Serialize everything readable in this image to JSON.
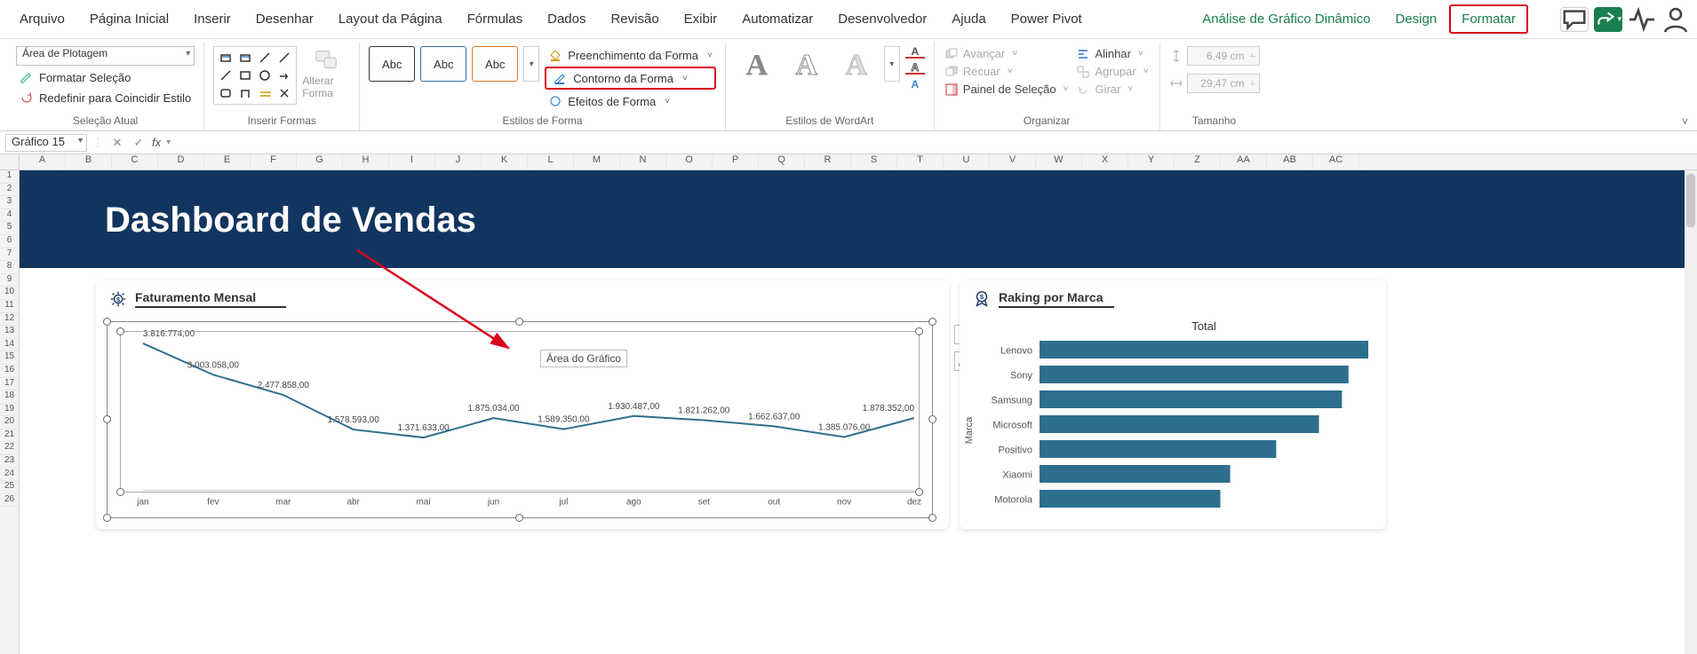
{
  "tabs": {
    "file": "Arquivo",
    "home": "Página Inicial",
    "insert": "Inserir",
    "draw": "Desenhar",
    "layout": "Layout da Página",
    "formulas": "Fórmulas",
    "data": "Dados",
    "review": "Revisão",
    "view": "Exibir",
    "automate": "Automatizar",
    "developer": "Desenvolvedor",
    "help": "Ajuda",
    "powerpivot": "Power Pivot",
    "ctx_analyze": "Análise de Gráfico Dinâmico",
    "ctx_design": "Design",
    "ctx_format": "Formatar"
  },
  "ribbon": {
    "current_selection": {
      "element": "Área de Plotagem",
      "format_selection": "Formatar Seleção",
      "reset": "Redefinir para Coincidir Estilo",
      "label": "Seleção Atual"
    },
    "insert_shapes": {
      "change": "Alterar Forma",
      "label": "Inserir Formas"
    },
    "shape_styles": {
      "abc": "Abc",
      "fill": "Preenchimento da Forma",
      "outline": "Contorno da Forma",
      "effects": "Efeitos de Forma",
      "label": "Estilos de Forma"
    },
    "wordart": {
      "label": "Estilos de WordArt"
    },
    "arrange": {
      "forward": "Avançar",
      "backward": "Recuar",
      "pane": "Painel de Seleção",
      "align": "Alinhar",
      "group": "Agrupar",
      "rotate": "Girar",
      "label": "Organizar"
    },
    "size": {
      "h": "6,49 cm",
      "w": "29,47 cm",
      "label": "Tamanho"
    }
  },
  "formula_bar": {
    "name": "Gráfico 15",
    "fx": "fx",
    "value": ""
  },
  "columns": [
    "A",
    "B",
    "C",
    "D",
    "E",
    "F",
    "G",
    "H",
    "I",
    "J",
    "K",
    "L",
    "M",
    "N",
    "O",
    "P",
    "Q",
    "R",
    "S",
    "T",
    "U",
    "V",
    "W",
    "X",
    "Y",
    "Z",
    "AA",
    "AB",
    "AC"
  ],
  "rows": [
    "1",
    "2",
    "3",
    "4",
    "5",
    "6",
    "7",
    "8",
    "9",
    "10",
    "11",
    "12",
    "13",
    "14",
    "15",
    "16",
    "17",
    "18",
    "19",
    "20",
    "21",
    "22",
    "23",
    "24",
    "25",
    "26"
  ],
  "dashboard": {
    "title": "Dashboard de Vendas",
    "chart1_title": "Faturamento Mensal",
    "chart2_title": "Raking por Marca",
    "chart2_inner": "Total",
    "chart2_ylabel": "Marca",
    "tooltip": "Área do Gráfico"
  },
  "chart_data": [
    {
      "type": "line",
      "title": "Faturamento Mensal",
      "categories": [
        "jan",
        "fev",
        "mar",
        "abr",
        "mai",
        "jun",
        "jul",
        "ago",
        "set",
        "out",
        "nov",
        "dez"
      ],
      "values": [
        3816774.0,
        3003058.0,
        2477858.0,
        1578593.0,
        1371633.0,
        1875034.0,
        1589350.0,
        1930487.0,
        1821262.0,
        1662637.0,
        1385076.0,
        1878352.0
      ],
      "labels": [
        "3.816.774,00",
        "3.003.058,00",
        "2.477.858,00",
        "1.578.593,00",
        "1.371.633,00",
        "1.875.034,00",
        "1.589.350,00",
        "1.930.487,00",
        "1.821.262,00",
        "1.662.637,00",
        "1.385.076,00",
        "1.878.352,00"
      ],
      "ylim": [
        0,
        4000000
      ]
    },
    {
      "type": "bar",
      "title": "Total",
      "ylabel": "Marca",
      "categories": [
        "Lenovo",
        "Sony",
        "Samsung",
        "Microsoft",
        "Positivo",
        "Xiaomi",
        "Motorola"
      ],
      "values": [
        100,
        94,
        92,
        85,
        72,
        58,
        55
      ],
      "xlim": [
        0,
        100
      ]
    }
  ]
}
